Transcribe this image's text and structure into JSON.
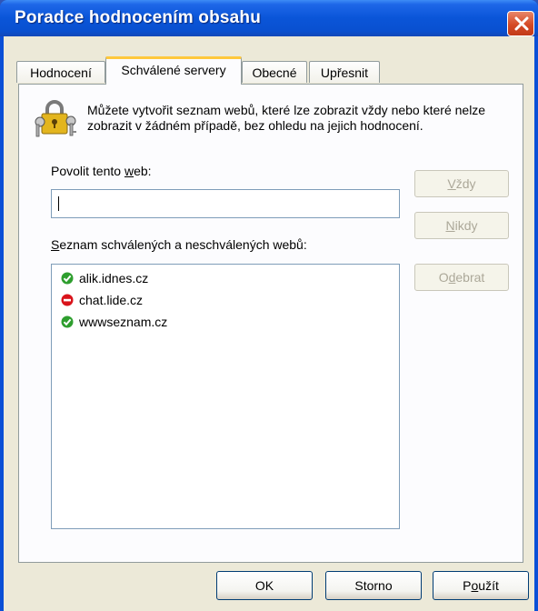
{
  "window": {
    "title": "Poradce hodnocením obsahu"
  },
  "tabs": [
    {
      "label": "Hodnocení",
      "active": false
    },
    {
      "label": "Schválené servery",
      "active": true
    },
    {
      "label": "Obecné",
      "active": false
    },
    {
      "label": "Upřesnit",
      "active": false
    }
  ],
  "info": {
    "text": "Můžete vytvořit seznam webů, které lze zobrazit vždy nebo které nelze zobrazit v žádném případě, bez ohledu na jejich hodnocení.",
    "icon": "keys-lock-icon"
  },
  "allow_site": {
    "label_pre": "Povolit tento ",
    "label_key": "w",
    "label_post": "eb:",
    "value": ""
  },
  "buttons": {
    "always": {
      "pre": "",
      "key": "V",
      "post": "ždy",
      "enabled": false
    },
    "never": {
      "pre": "",
      "key": "N",
      "post": "ikdy",
      "enabled": false
    },
    "remove": {
      "pre": "O",
      "key": "d",
      "post": "ebrat",
      "enabled": false
    }
  },
  "list": {
    "label_pre": "",
    "label_key": "S",
    "label_post": "eznam schválených a neschválených webů:",
    "items": [
      {
        "site": "alik.idnes.cz",
        "status": "allowed",
        "icon": "check-icon"
      },
      {
        "site": "chat.lide.cz",
        "status": "blocked",
        "icon": "no-entry-icon"
      },
      {
        "site": "wwwseznam.cz",
        "status": "allowed",
        "icon": "check-icon"
      }
    ]
  },
  "footer": {
    "ok": "OK",
    "cancel": "Storno",
    "apply_pre": "P",
    "apply_key": "o",
    "apply_post": "užít"
  },
  "colors": {
    "allowed": "#2e9e2e",
    "blocked": "#d9141b",
    "title_bar": "#0a55d8",
    "dialog_bg": "#ece9d8"
  }
}
